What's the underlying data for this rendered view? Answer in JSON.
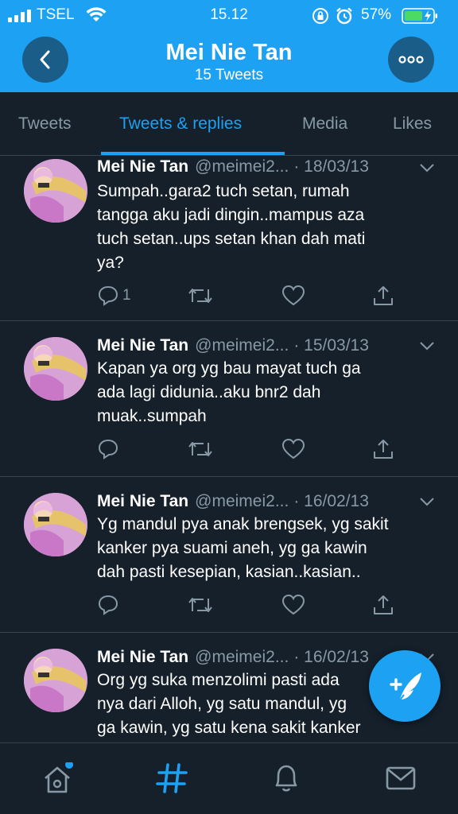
{
  "status_bar": {
    "carrier": "TSEL",
    "time": "15.12",
    "battery": "57%"
  },
  "header": {
    "name": "Mei Nie Tan",
    "tweet_count": "15 Tweets",
    "back_icon": "back-arrow-icon",
    "more_icon": "more-dots-icon"
  },
  "tabs": [
    {
      "label": "Tweets",
      "active": false
    },
    {
      "label": "Tweets & replies",
      "active": true
    },
    {
      "label": "Media",
      "active": false
    },
    {
      "label": "Likes",
      "active": false
    }
  ],
  "tweets": [
    {
      "name": "Mei Nie Tan",
      "handle": "@meimei2...",
      "date": "· 18/03/13",
      "lines": [
        "Sumpah..gara2 tuch setan, rumah",
        "tangga aku jadi dingin..mampus aza",
        "tuch setan..ups setan khan dah mati",
        "ya?"
      ],
      "reply_count": "1"
    },
    {
      "name": "Mei Nie Tan",
      "handle": "@meimei2...",
      "date": "· 15/03/13",
      "lines": [
        "Kapan ya org yg bau mayat tuch ga",
        "ada lagi didunia..aku bnr2 dah",
        "muak..sumpah"
      ],
      "reply_count": ""
    },
    {
      "name": "Mei Nie Tan",
      "handle": "@meimei2...",
      "date": "· 16/02/13",
      "lines": [
        "Yg mandul pya anak brengsek, yg sakit",
        "kanker pya suami aneh, yg ga kawin",
        "dah pasti kesepian, kasian..kasian.."
      ],
      "reply_count": ""
    },
    {
      "name": "Mei Nie Tan",
      "handle": "@meimei2...",
      "date": "· 16/02/13",
      "lines": [
        "Org yg suka menzolimi pasti ada",
        "nya dari Alloh, yg satu mandul, yg",
        "ga kawin, yg satu kena sakit kanker"
      ],
      "reply_count": ""
    }
  ],
  "bottom_nav": [
    {
      "icon": "home-icon",
      "has_badge": true
    },
    {
      "icon": "explore-hashtag-icon",
      "active": true
    },
    {
      "icon": "notifications-bell-icon"
    },
    {
      "icon": "messages-envelope-icon"
    }
  ],
  "colors": {
    "accent": "#1da1f2",
    "background": "#15202b",
    "muted_text": "#8899a6",
    "divider": "#38444d"
  }
}
